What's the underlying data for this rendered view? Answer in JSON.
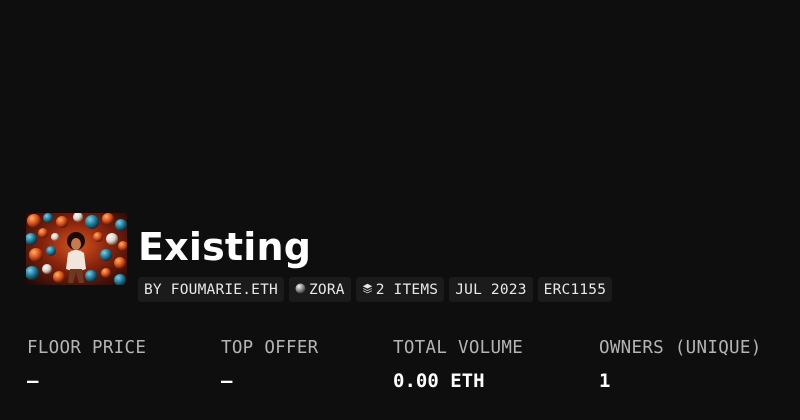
{
  "collection": {
    "title": "Existing",
    "thumbnail_alt": "Collection artwork"
  },
  "tags": [
    {
      "label": "BY FOUMARIE.ETH",
      "icon": ""
    },
    {
      "label": "ZORA",
      "icon": "zora-sphere-icon"
    },
    {
      "label": "2 ITEMS",
      "icon": "layers-icon"
    },
    {
      "label": "JUL 2023",
      "icon": ""
    },
    {
      "label": "ERC1155",
      "icon": ""
    }
  ],
  "stats": [
    {
      "label": "FLOOR PRICE",
      "value": "—"
    },
    {
      "label": "TOP OFFER",
      "value": "—"
    },
    {
      "label": "TOTAL VOLUME",
      "value": "0.00 ETH"
    },
    {
      "label": "OWNERS (UNIQUE)",
      "value": "1"
    }
  ],
  "colors": {
    "background": "#0e0e0e",
    "tag_background": "#1b1b1b",
    "label_text": "#b4b4b4",
    "value_text": "#ffffff"
  }
}
